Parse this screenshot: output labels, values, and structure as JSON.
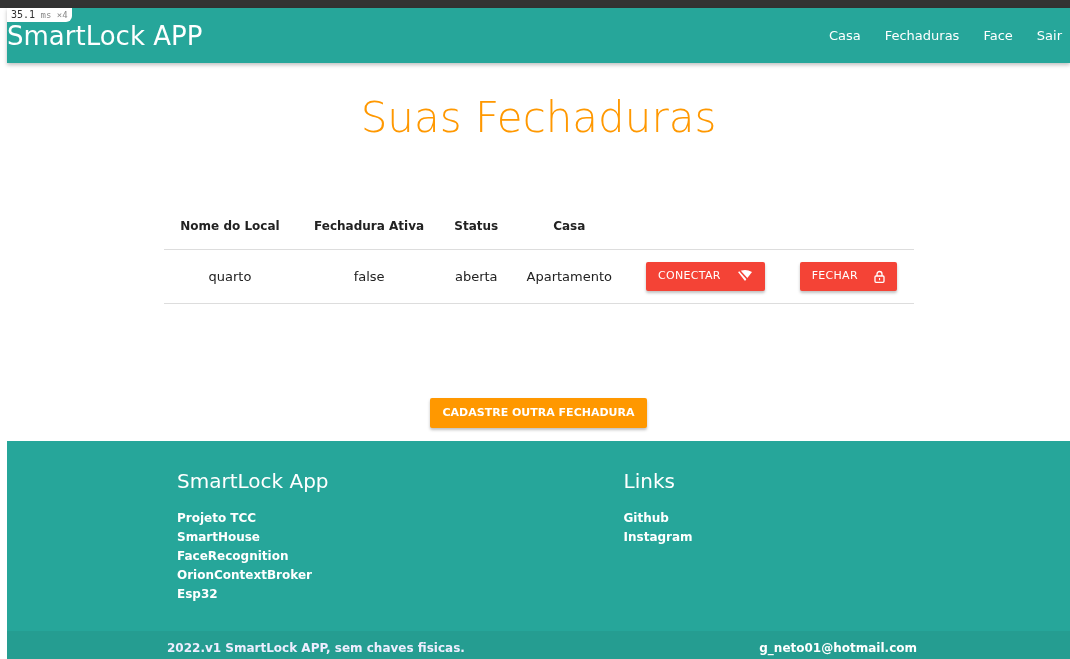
{
  "perf_badge": {
    "value": "35.1",
    "unit": "ms",
    "multiplier": "×4"
  },
  "navbar": {
    "brand": "SmartLock APP",
    "links": [
      "Casa",
      "Fechaduras",
      "Face",
      "Sair"
    ]
  },
  "title": "Suas Fechaduras",
  "table": {
    "columns": [
      "Nome do Local",
      "Fechadura Ativa",
      "Status",
      "Casa"
    ],
    "rows": [
      {
        "cells": [
          "quarto",
          "false",
          "aberta",
          "Apartamento"
        ],
        "actions": [
          {
            "label": "CONECTAR",
            "kind": "connect"
          },
          {
            "label": "FECHAR",
            "kind": "close"
          }
        ]
      }
    ]
  },
  "add_button": "CADASTRE OUTRA FECHADURA",
  "footer": {
    "sections": [
      {
        "title": "SmartLock App",
        "links": [
          "Projeto TCC",
          "SmartHouse",
          "FaceRecognition",
          "OrionContextBroker",
          "Esp32"
        ]
      },
      {
        "title": "Links",
        "links": [
          "Github",
          "Instagram"
        ]
      }
    ],
    "copyright": "2022.v1 SmartLock APP, sem chaves fisicas.",
    "email": "g_neto01@hotmail.com"
  }
}
